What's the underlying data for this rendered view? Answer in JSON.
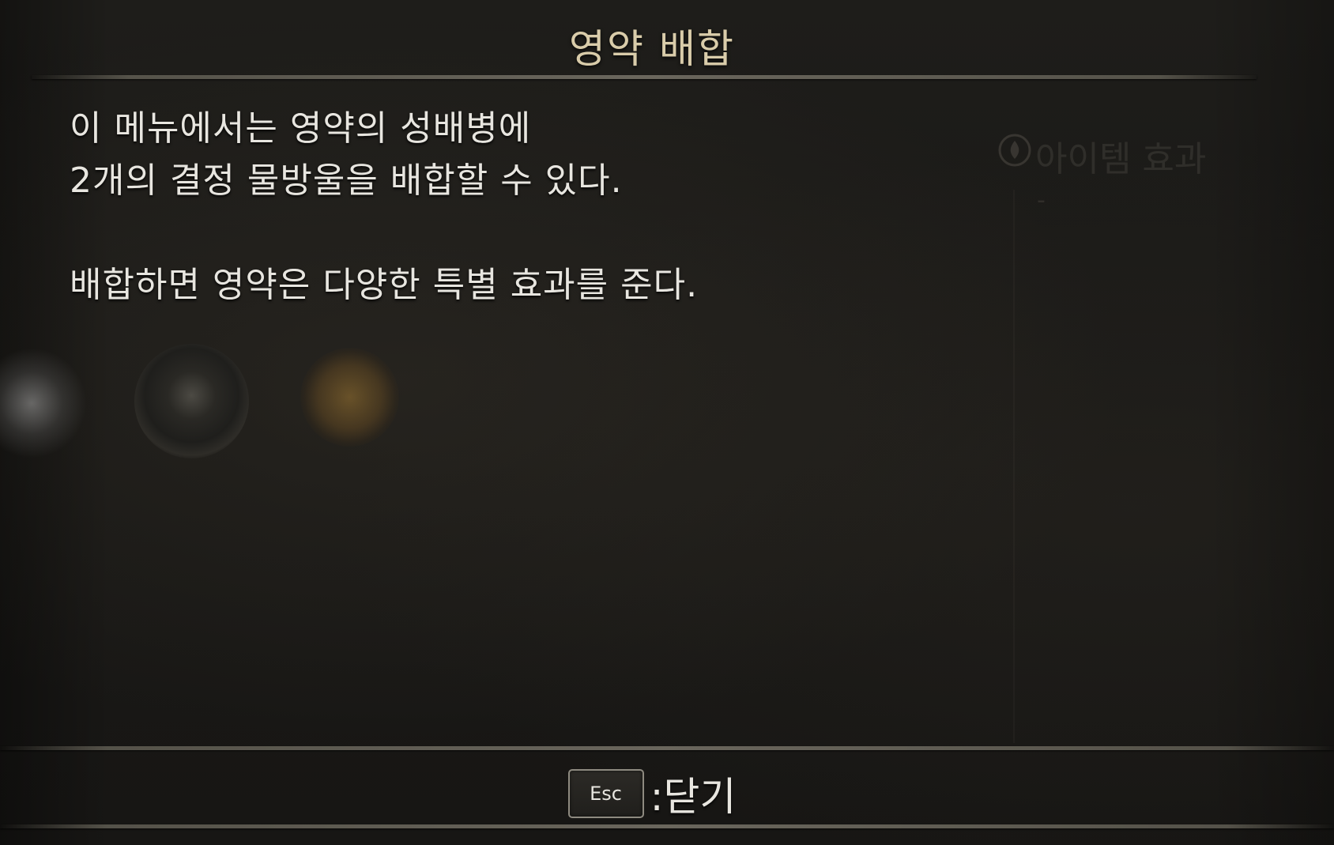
{
  "dialog": {
    "title": "영약 배합",
    "description": {
      "line1": "이 메뉴에서는 영약의 성배병에",
      "line2": "2개의 결정 물방울을 배합할 수 있다.",
      "line3": "배합하면 영약은 다양한 특별 효과를 준다."
    }
  },
  "background": {
    "item_effect_label": "아이템 효과",
    "item_effect_value": "-",
    "item_effect_icon": "flame-emblem-icon"
  },
  "footer": {
    "key_label": "Esc",
    "action_label": ":닫기"
  },
  "colors": {
    "title": "#d9ccaa",
    "text": "#e8e6e0",
    "background": "#1a1916"
  }
}
